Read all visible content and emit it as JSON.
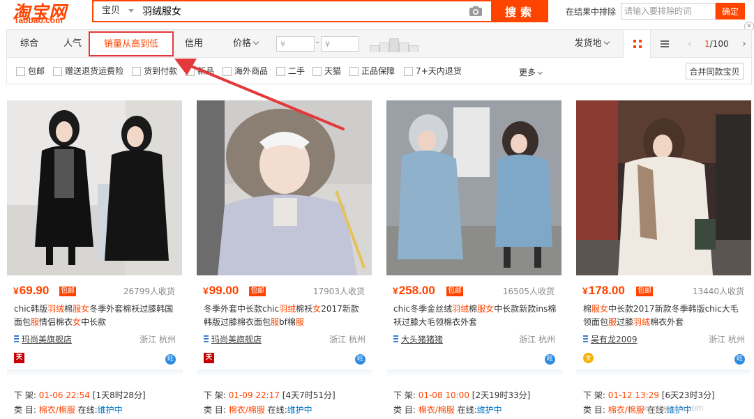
{
  "header": {
    "logo_cn": "淘宝网",
    "logo_en": "Taobao.com",
    "search_category": "宝贝",
    "search_query": "羽绒服女",
    "search_button": "搜索",
    "exclude_label": "在结果中排除",
    "exclude_placeholder": "请输入要排除的词",
    "exclude_button": "确定"
  },
  "sort_tabs": {
    "comprehensive": "综合",
    "popularity": "人气",
    "sales": "销量从高到低",
    "credit": "信用",
    "price": "价格"
  },
  "price_filter": {
    "min_placeholder": "¥",
    "max_placeholder": "¥",
    "dash": "-"
  },
  "ship_from": "发货地",
  "pager": {
    "current": "1",
    "total": "/100"
  },
  "filters": [
    "包邮",
    "赠送退货运费险",
    "货到付款",
    "新品",
    "海外商品",
    "二手",
    "天猫",
    "正品保障",
    "7+天内退货"
  ],
  "more_label": "更多",
  "merge_button": "合并同款宝贝",
  "products": [
    {
      "price": "69.90",
      "currency": "¥",
      "badge": "包邮",
      "sales": "26799人收货",
      "title": "chic韩版羽绒棉服女冬季外套棉袄过膝韩国面包服情侣棉衣女中长款",
      "shop": "玛尚美旗舰店",
      "location": "浙江 杭州",
      "shop_badge": "天",
      "ww": "旺",
      "delist_label": "下 架:",
      "delist_time": "01-06 22:54",
      "delist_remain": "[1天8时28分]",
      "category_label": "类 目:",
      "category": "棉衣/棉服",
      "online_label": "在线:",
      "online_status": "维护中"
    },
    {
      "price": "99.00",
      "currency": "¥",
      "badge": "包邮",
      "sales": "17903人收货",
      "title": "冬季外套中长款chic羽绒棉袄女2017新款韩版过膝棉衣面包服bf棉服",
      "shop": "玛尚美旗舰店",
      "location": "浙江 杭州",
      "shop_badge": "天",
      "ww": "旺",
      "delist_label": "下 架:",
      "delist_time": "01-09 22:17",
      "delist_remain": "[4天7时51分]",
      "category_label": "类 目:",
      "category": "棉衣/棉服",
      "online_label": "在线:",
      "online_status": "维护中"
    },
    {
      "price": "258.00",
      "currency": "¥",
      "badge": "包邮",
      "sales": "16505人收货",
      "title": "chic冬季金丝绒羽绒棉服女中长款新款ins棉袄过膝大毛领棉衣外套",
      "shop": "大头猪猪猪",
      "location": "浙江 杭州",
      "shop_badge": "",
      "ww": "旺",
      "delist_label": "下 架:",
      "delist_time": "01-08 10:00",
      "delist_remain": "[2天19时33分]",
      "category_label": "类 目:",
      "category": "棉衣/棉服",
      "online_label": "在线:",
      "online_status": "维护中"
    },
    {
      "price": "178.00",
      "currency": "¥",
      "badge": "包邮",
      "sales": "13440人收货",
      "title": "棉服女中长款2017新款冬季韩版chic大毛领面包服过膝羽绒棉衣外套",
      "shop": "吴有龙2009",
      "location": "浙江 杭州",
      "shop_badge": "金",
      "ww": "旺",
      "delist_label": "下 架:",
      "delist_time": "01-12 13:29",
      "delist_remain": "[6天23时3分]",
      "category_label": "类 目:",
      "category": "棉衣/棉服",
      "online_label": "在线:",
      "online_status": "维护中"
    }
  ],
  "watermark": "www.maijia.com",
  "colors": {
    "brand": "#ff4400",
    "annotation": "#e4393c",
    "link": "#0077cc"
  }
}
